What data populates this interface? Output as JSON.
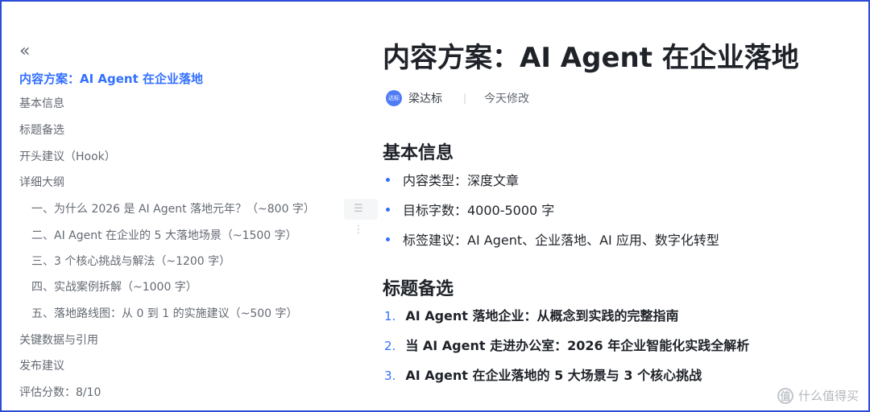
{
  "outline": {
    "collapse_icon": "«",
    "items": [
      {
        "label": "内容方案：AI Agent 在企业落地"
      },
      {
        "label": "基本信息"
      },
      {
        "label": "标题备选"
      },
      {
        "label": "开头建议（Hook）"
      },
      {
        "label": "详细大纲"
      },
      {
        "label": "一、为什么 2026 是 AI Agent 落地元年？（~800 字）"
      },
      {
        "label": "二、AI Agent 在企业的 5 大落地场景（~1500 字）"
      },
      {
        "label": "三、3 个核心挑战与解法（~1200 字）"
      },
      {
        "label": "四、实战案例拆解（~1000 字）"
      },
      {
        "label": "五、落地路线图：从 0 到 1 的实施建议（~500 字）"
      },
      {
        "label": "关键数据与引用"
      },
      {
        "label": "发布建议"
      },
      {
        "label": "评估分数：8/10"
      }
    ]
  },
  "drag_handle": "☰ ⋮",
  "doc": {
    "title": "内容方案：AI Agent 在企业落地",
    "author": {
      "avatar_text": "达标",
      "name": "梁达标"
    },
    "separator": "|",
    "modified": "今天修改",
    "section1": {
      "heading": "基本信息",
      "bullets": [
        "内容类型：深度文章",
        "目标字数：4000-5000 字",
        "标签建议：AI Agent、企业落地、AI 应用、数字化转型"
      ]
    },
    "section2": {
      "heading": "标题备选",
      "items": [
        {
          "num": "1.",
          "text": "AI Agent 落地企业：从概念到实践的完整指南"
        },
        {
          "num": "2.",
          "text": "当 AI Agent 走进办公室：2026 年企业智能化实践全解析"
        },
        {
          "num": "3.",
          "text": "AI Agent 在企业落地的 5 大场景与 3 个核心挑战"
        }
      ]
    }
  },
  "watermark": {
    "logo": "值",
    "text": "什么值得买"
  },
  "colors": {
    "accent": "#3370ff",
    "frame": "#2b4bd8"
  }
}
